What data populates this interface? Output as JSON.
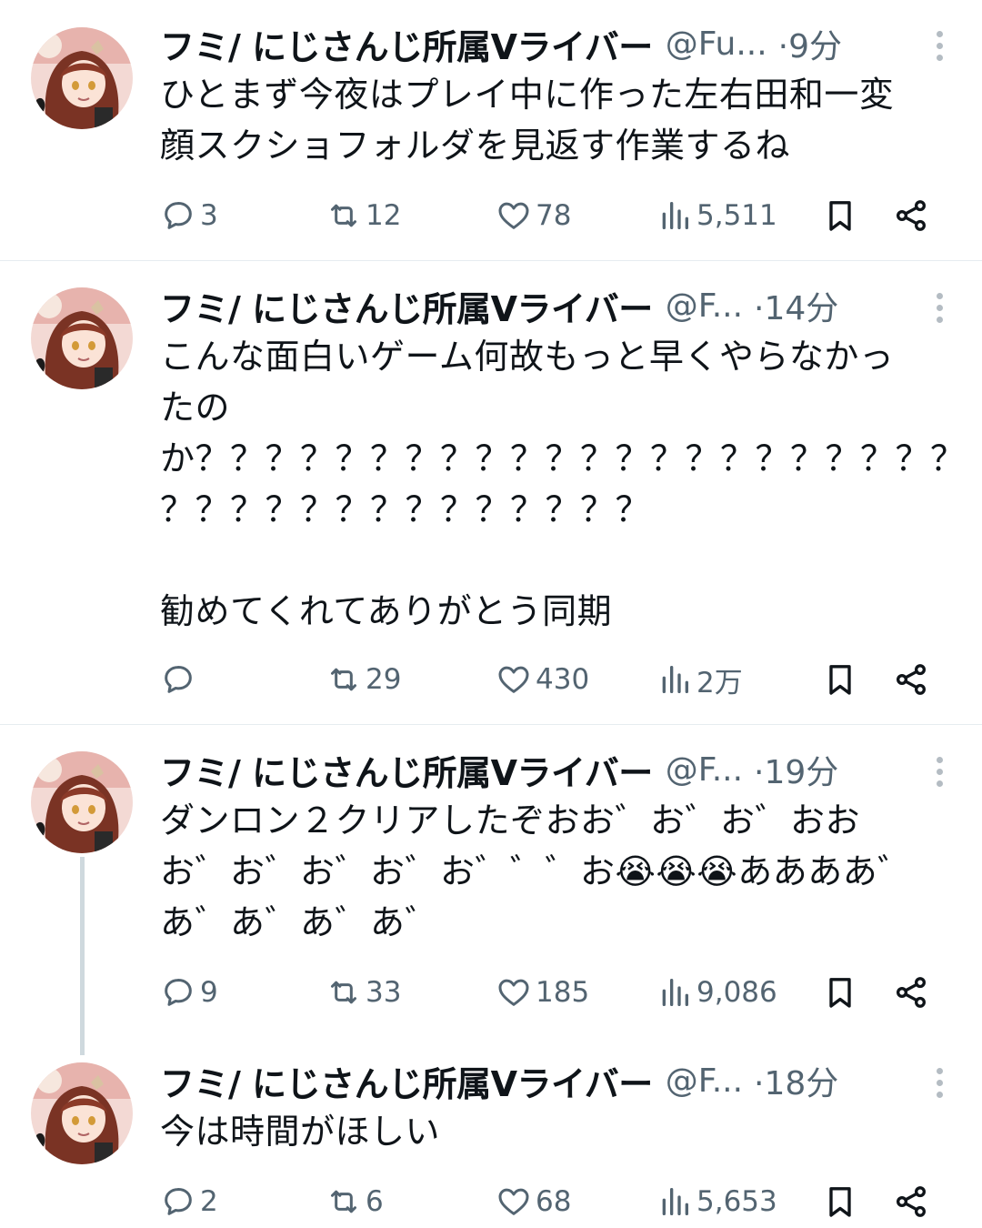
{
  "tweets": [
    {
      "name": "フミ/ にじさんじ所属Vライバー",
      "handle": "@Fu...",
      "time": "·9分",
      "text": "ひとまず今夜はプレイ中に作った左右田和一変\n顔スクショフォルダを見返す作業するね",
      "replies": "3",
      "retweets": "12",
      "likes": "78",
      "views": "5,511"
    },
    {
      "name": "フミ/ にじさんじ所属Vライバー",
      "handle": "@F...",
      "time": "·14分",
      "text": "こんな面白いゲーム何故もっと早くやらなかっ\nたの\nか？？？？？？？？？？？？？？？？？？？？？？\n？？？？？？？？？？？？？？\n\n勧めてくれてありがとう同期",
      "replies": "",
      "retweets": "29",
      "likes": "430",
      "views": "2万"
    },
    {
      "name": "フミ/ にじさんじ所属Vライバー",
      "handle": "@F...",
      "time": "·19分",
      "text": "ダンロン２クリアしたぞおお゛お゛お゛おお\nお゛お゛お゛お゛お゛゛゛お😭😭😭ああああ゛\nあ゛あ゛あ゛あ゛",
      "replies": "9",
      "retweets": "33",
      "likes": "185",
      "views": "9,086"
    },
    {
      "name": "フミ/ にじさんじ所属Vライバー",
      "handle": "@F...",
      "time": "·18分",
      "text": "今は時間がほしい",
      "replies": "2",
      "retweets": "6",
      "likes": "68",
      "views": "5,653"
    }
  ],
  "colors": {
    "text": "#0f1419",
    "secondary": "#536471",
    "divider": "#e6ecf0",
    "thread_line": "#cfd9de"
  },
  "icons": [
    "reply-icon",
    "retweet-icon",
    "like-icon",
    "views-icon",
    "bookmark-icon",
    "share-icon",
    "more-icon"
  ]
}
